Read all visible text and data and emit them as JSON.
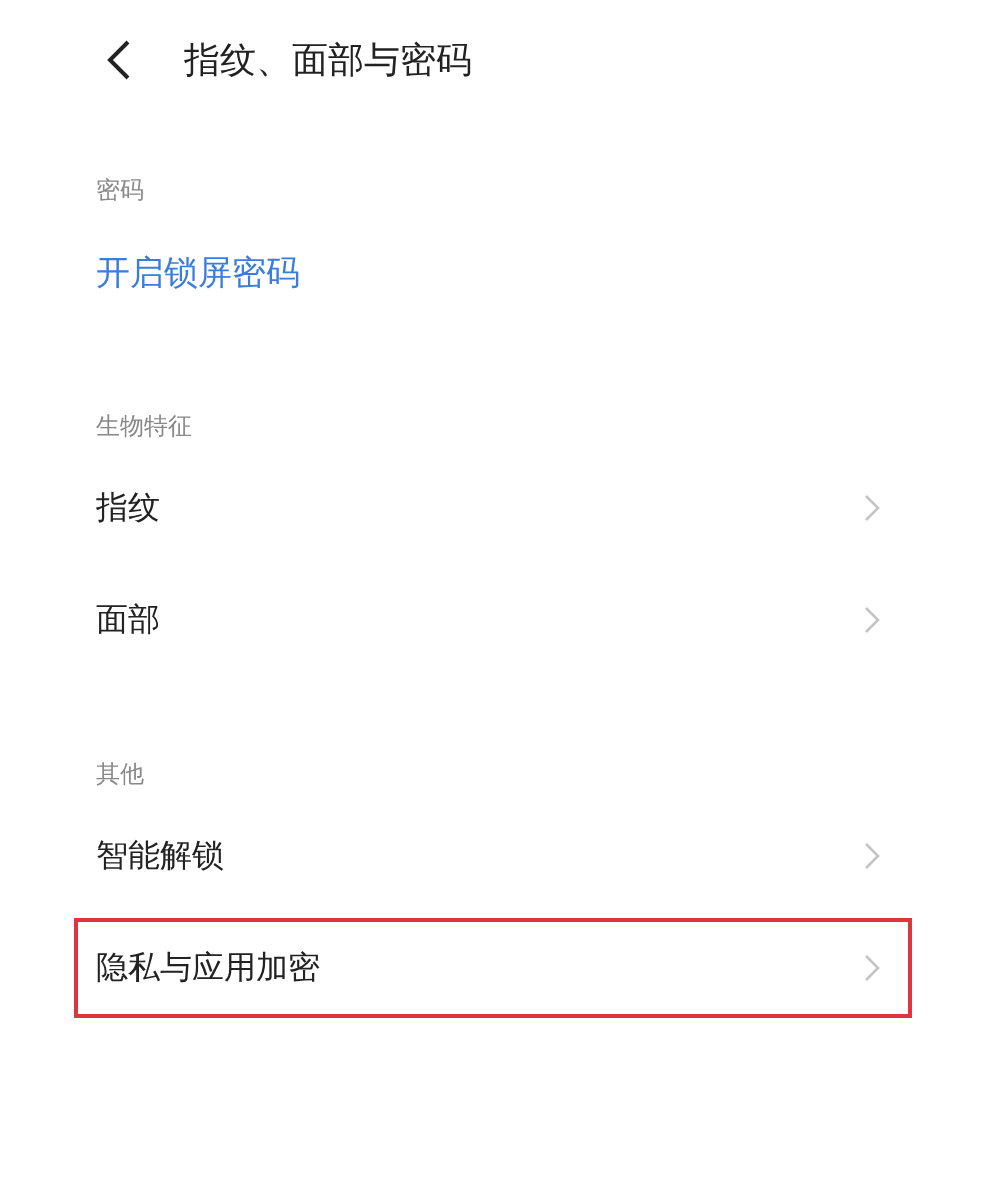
{
  "header": {
    "title": "指纹、面部与密码"
  },
  "sections": [
    {
      "title": "密码",
      "items": [
        {
          "label": "开启锁屏密码",
          "kind": "link",
          "highlighted": false
        }
      ]
    },
    {
      "title": "生物特征",
      "items": [
        {
          "label": "指纹",
          "kind": "nav",
          "highlighted": false
        },
        {
          "label": "面部",
          "kind": "nav",
          "highlighted": false
        }
      ]
    },
    {
      "title": "其他",
      "items": [
        {
          "label": "智能解锁",
          "kind": "nav",
          "highlighted": false
        },
        {
          "label": "隐私与应用加密",
          "kind": "nav",
          "highlighted": true
        }
      ]
    }
  ]
}
